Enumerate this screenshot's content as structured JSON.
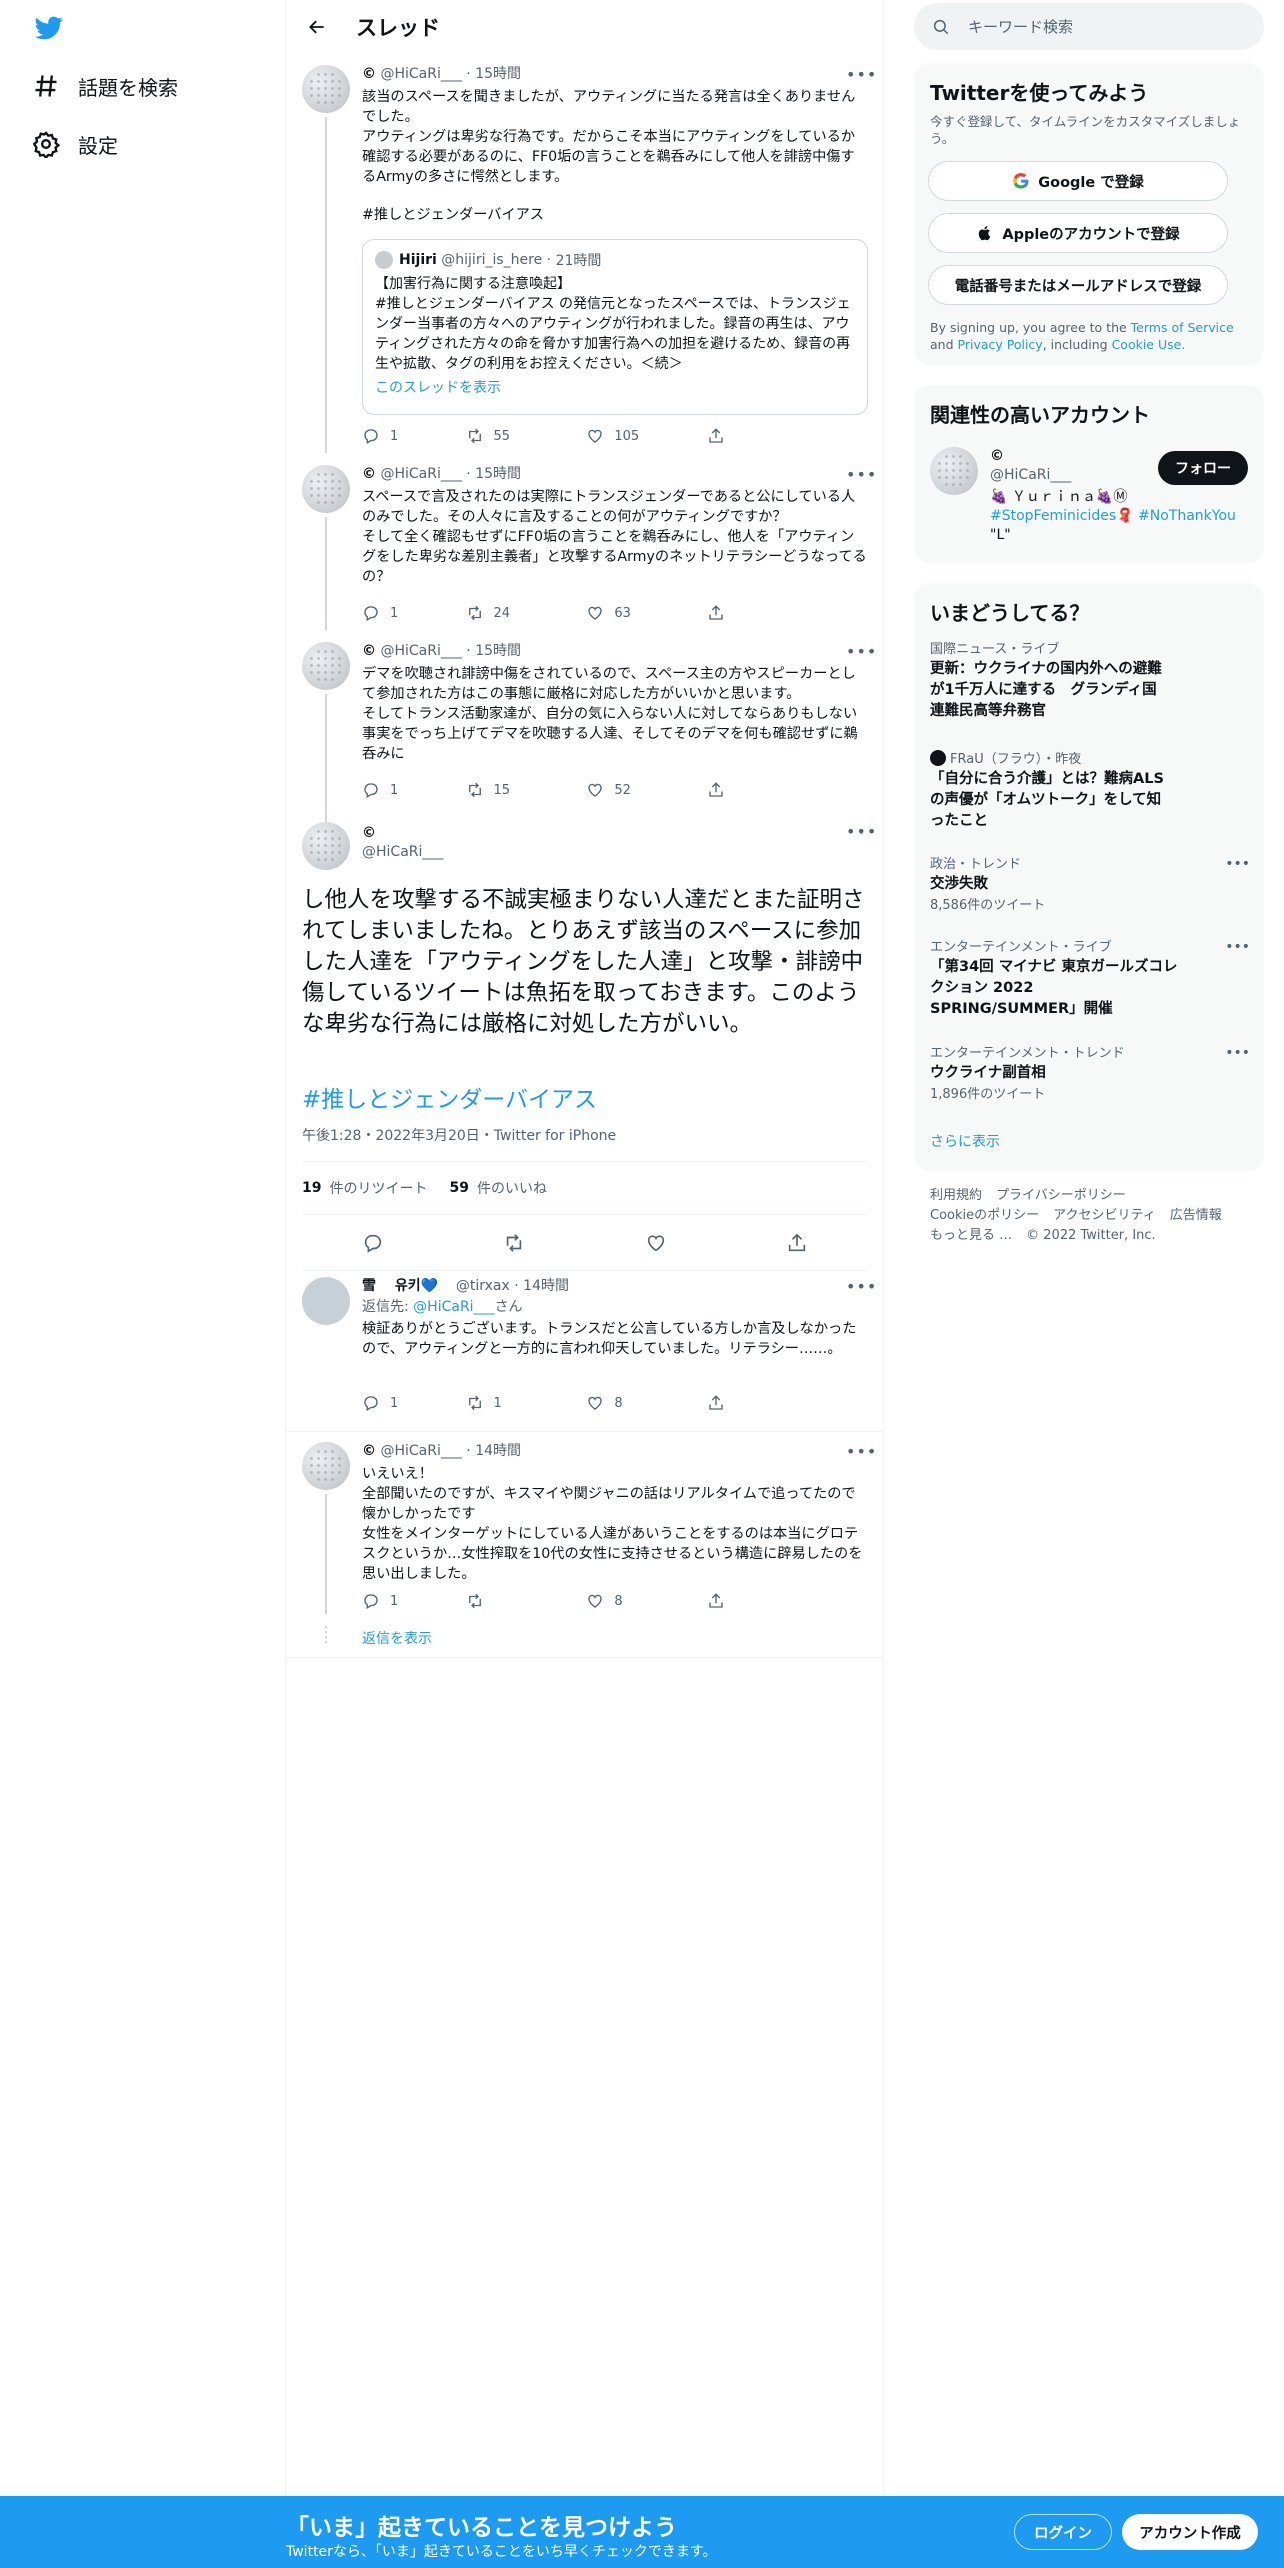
{
  "nav": {
    "logo": "twitter-bird",
    "explore": "話題を検索",
    "settings": "設定"
  },
  "header": {
    "title": "スレッド"
  },
  "tweets": [
    {
      "name": "©",
      "handle": "@HiCaRi___",
      "time": "15時間",
      "text": "該当のスペースを聞きましたが、アウティングに当たる発言は全くありませんでした。\nアウティングは卑劣な行為です。だからこそ本当にアウティングをしているか確認する必要があるのに、FF0垢の言うことを鵜呑みにして他人を誹謗中傷するArmyの多さに愕然とします。",
      "hashtag": "#推しとジェンダーバイアス",
      "quote": {
        "name": "Hijiri",
        "handle": "@hijiri_is_here",
        "time": "21時間",
        "text": "【加害行為に関する注意喚起】\n#推しとジェンダーバイアス の発信元となったスペースでは、トランスジェンダー当事者の方々へのアウティングが行われました。録音の再生は、アウティングされた方々の命を脅かす加害行為への加担を避けるため、録音の再生や拡散、タグの利用をお控えください。＜続＞",
        "show_thread": "このスレッドを表示"
      },
      "replies": "1",
      "retweets": "55",
      "likes": "105"
    },
    {
      "name": "©",
      "handle": "@HiCaRi___",
      "time": "15時間",
      "text": "スペースで言及されたのは実際にトランスジェンダーであると公にしている人のみでした。その人々に言及することの何がアウティングですか？\nそして全く確認もせずにFF0垢の言うことを鵜呑みにし、他人を「アウティングをした卑劣な差別主義者」と攻撃するArmyのネットリテラシーどうなってるの？",
      "replies": "1",
      "retweets": "24",
      "likes": "63"
    },
    {
      "name": "©",
      "handle": "@HiCaRi___",
      "time": "15時間",
      "text": "デマを吹聴され誹謗中傷をされているので、スペース主の方やスピーカーとして参加された方はこの事態に厳格に対応した方がいいかと思います。\nそしてトランス活動家達が、自分の気に入らない人に対してならありもしない事実をでっち上げてデマを吹聴する人達、そしてそのデマを何も確認せずに鵜呑みに",
      "replies": "1",
      "retweets": "15",
      "likes": "52"
    }
  ],
  "main_tweet": {
    "name": "©",
    "handle": "@HiCaRi___",
    "text": "し他人を攻撃する不誠実極まりない人達だとまた証明されてしまいましたね。とりあえず該当のスペースに参加した人達を「アウティングをした人達」と攻撃・誹謗中傷しているツイートは魚拓を取っておきます。このような卑劣な行為には厳格に対処した方がいい。",
    "hashtag": "#推しとジェンダーバイアス",
    "meta": "午後1:28・2022年3月20日・Twitter for iPhone",
    "retweets_count": "19",
    "retweets_label": "件のリツイート",
    "likes_count": "59",
    "likes_label": "件のいいね"
  },
  "reply_tweets": [
    {
      "name": "雪　 유키💙",
      "handle": "@tirxax",
      "time": "14時間",
      "reply_to_label": "返信先:",
      "reply_to_handle": "@HiCaRi___",
      "reply_to_suffix": "さん",
      "text": "検証ありがとうございます。トランスだと公言している方しか言及しなかったので、アウティングと一方的に言われ仰天していました。リテラシー……。",
      "replies": "1",
      "retweets": "1",
      "likes": "8"
    },
    {
      "name": "©",
      "handle": "@HiCaRi___",
      "time": "14時間",
      "text": "いえいえ！\n全部聞いたのですが、キスマイや関ジャニの話はリアルタイムで追ってたので懐かしかったです\n女性をメインターゲットにしている人達があいうことをするのは本当にグロテスクというか…女性搾取を10代の女性に支持させるという構造に辟易したのを思い出しました。",
      "replies": "1",
      "retweets": "",
      "likes": "8",
      "show_replies": "返信を表示"
    }
  ],
  "search": {
    "placeholder": "キーワード検索"
  },
  "signup_card": {
    "title": "Twitterを使ってみよう",
    "subtitle": "今すぐ登録して、タイムラインをカスタマイズしましょう。",
    "google": "Google で登録",
    "apple": "Appleのアカウントで登録",
    "phone": "電話番号またはメールアドレスで登録",
    "terms_prefix": "By signing up, you agree to the",
    "terms": "Terms of Service",
    "and": "and",
    "privacy": "Privacy Policy",
    "including": ", including",
    "cookie": "Cookie Use."
  },
  "related": {
    "title": "関連性の高いアカウント",
    "name": "©",
    "handle": "@HiCaRi___",
    "bio_line1": "🍇 Ｙｕｒｉｎａ🍇Ⓜ",
    "bio_tag1": "#StopFeminicides",
    "bio_tag2": "#NoThankYou",
    "bio_line3": "\"L\"",
    "follow": "フォロー"
  },
  "trends": {
    "title": "いまどうしてる？",
    "items": [
      {
        "cat": "国際ニュース・ライブ",
        "title": "更新：ウクライナの国内外への避難が1千万人に達する　グランディ国連難民高等弁務官",
        "count": ""
      },
      {
        "cat": "FRaU（フラウ）・昨夜",
        "title": "「自分に合う介護」とは？難病ALSの声優が「オムツトーク」をして知ったこと",
        "count": ""
      },
      {
        "cat": "政治・トレンド",
        "title": "交渉失敗",
        "count": "8,586件のツイート"
      },
      {
        "cat": "エンターテインメント・ライブ",
        "title": "「第34回 マイナビ 東京ガールズコレクション 2022 SPRING/SUMMER」開催",
        "count": ""
      },
      {
        "cat": "エンターテインメント・トレンド",
        "title": "ウクライナ副首相",
        "count": "1,896件のツイート"
      }
    ],
    "more": "さらに表示"
  },
  "footer": {
    "terms": "利用規約",
    "privacy": "プライバシーポリシー",
    "cookie": "Cookieのポリシー",
    "access": "アクセシビリティ",
    "ads": "広告情報",
    "more": "もっと見る …",
    "copy": "© 2022 Twitter, Inc."
  },
  "bottom_bar": {
    "headline": "「いま」起きていることを見つけよう",
    "sub": "Twitterなら、「いま」起きていることをいち早くチェックできます。",
    "login": "ログイン",
    "signup": "アカウント作成"
  },
  "colors": {
    "accent": "#1d9bf0",
    "text": "#0f1419",
    "muted": "#536471"
  }
}
